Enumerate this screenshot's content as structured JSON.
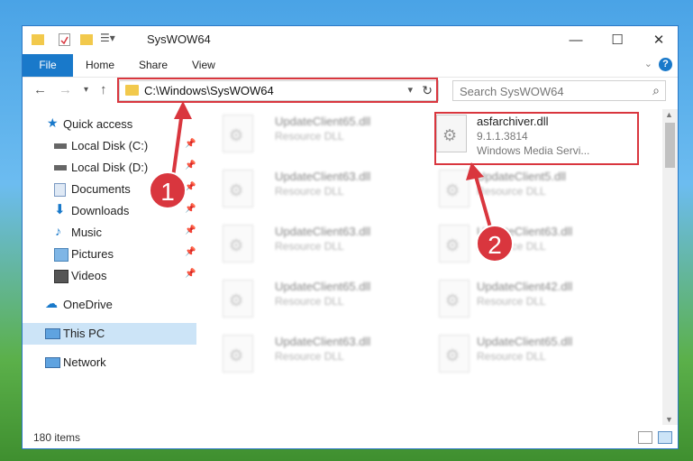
{
  "window": {
    "title": "SysWOW64",
    "controls": {
      "minimize": "—",
      "maximize": "☐",
      "close": "✕"
    }
  },
  "ribbon": {
    "tabs": [
      "File",
      "Home",
      "Share",
      "View"
    ]
  },
  "navigation": {
    "address": "C:\\Windows\\SysWOW64",
    "search_placeholder": "Search SysWOW64"
  },
  "sidebar": {
    "items": [
      {
        "label": "Quick access",
        "icon": "star-icon",
        "pinned": false
      },
      {
        "label": "Local Disk (C:)",
        "icon": "drive-icon",
        "pinned": true
      },
      {
        "label": "Local Disk (D:)",
        "icon": "drive-icon",
        "pinned": true
      },
      {
        "label": "Documents",
        "icon": "documents-icon",
        "pinned": true
      },
      {
        "label": "Downloads",
        "icon": "downloads-icon",
        "pinned": true
      },
      {
        "label": "Music",
        "icon": "music-icon",
        "pinned": true
      },
      {
        "label": "Pictures",
        "icon": "pictures-icon",
        "pinned": true
      },
      {
        "label": "Videos",
        "icon": "videos-icon",
        "pinned": true
      },
      {
        "label": "OneDrive",
        "icon": "cloud-icon",
        "pinned": false
      },
      {
        "label": "This PC",
        "icon": "computer-icon",
        "pinned": false
      },
      {
        "label": "Network",
        "icon": "network-icon",
        "pinned": false
      }
    ]
  },
  "files": {
    "left": [
      {
        "name": "UpdateClient65.dll",
        "type": "Resource DLL"
      },
      {
        "name": "UpdateClient63.dll",
        "type": "Resource DLL"
      },
      {
        "name": "UpdateClient63.dll",
        "type": "Resource DLL"
      },
      {
        "name": "UpdateClient65.dll",
        "type": "Resource DLL"
      },
      {
        "name": "UpdateClient63.dll",
        "type": "Resource DLL"
      }
    ],
    "right": [
      {
        "name": "asfarchiver.dll",
        "version": "9.1.1.3814",
        "desc": "Windows Media Servi..."
      },
      {
        "name": "UpdateClient5.dll",
        "type": "Resource DLL"
      },
      {
        "name": "UpdateClient63.dll",
        "type": "Resource DLL"
      },
      {
        "name": "UpdateClient42.dll",
        "type": "Resource DLL"
      },
      {
        "name": "UpdateClient65.dll",
        "type": "Resource DLL"
      }
    ]
  },
  "status": {
    "items": "180 items"
  },
  "annotations": {
    "callout1": "1",
    "callout2": "2",
    "color": "#d9363e"
  }
}
